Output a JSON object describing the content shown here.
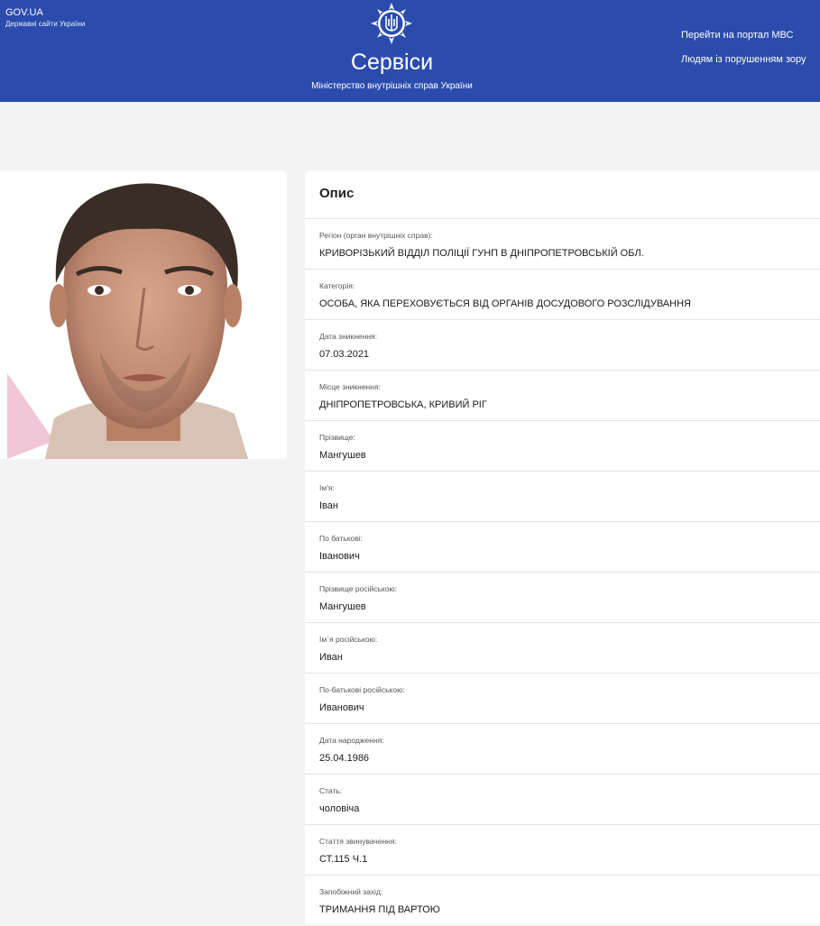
{
  "header": {
    "gov_title": "GOV.UA",
    "gov_subtitle": "Державні сайти України",
    "site_title": "Сервіси",
    "site_subtitle": "Міністерство внутрішніх справ України",
    "links": {
      "portal": "Перейти на портал МВС",
      "vision": "Людям із порушенням зору"
    },
    "colors": {
      "header_bg": "#2b4cad",
      "page_bg": "#f3f3f3"
    }
  },
  "photo": {
    "icon": "person-photo"
  },
  "description": {
    "title": "Опис",
    "fields": [
      {
        "label": "Регіон (орган внутрішніх справ):",
        "value": "КРИВОРІЗЬКИЙ ВІДДІЛ ПОЛІЦІЇ ГУНП В ДНІПРОПЕТРОВСЬКІЙ ОБЛ."
      },
      {
        "label": "Категорія:",
        "value": "ОСОБА, ЯКА ПЕРЕХОВУЄТЬСЯ ВІД ОРГАНІВ ДОСУДОВОГО РОЗСЛІДУВАННЯ"
      },
      {
        "label": "Дата зникнення:",
        "value": "07.03.2021"
      },
      {
        "label": "Місце зникнення:",
        "value": "ДНІПРОПЕТРОВСЬКА, КРИВИЙ РІГ"
      },
      {
        "label": "Прізвище:",
        "value": "Мангушев"
      },
      {
        "label": "Ім'я:",
        "value": "Іван"
      },
      {
        "label": "По батькові:",
        "value": "Іванович"
      },
      {
        "label": "Прізвище російською:",
        "value": "Мангушев"
      },
      {
        "label": "Ім`я російською:",
        "value": "Иван"
      },
      {
        "label": "По-батькові російською:",
        "value": "Иванович"
      },
      {
        "label": "Дата народження:",
        "value": "25.04.1986"
      },
      {
        "label": "Стать:",
        "value": "чоловіча"
      },
      {
        "label": "Стаття звинувачення:",
        "value": "СТ.115 Ч.1"
      },
      {
        "label": "Запобіжний захід:",
        "value": "ТРИМАННЯ ПІД ВАРТОЮ"
      }
    ]
  }
}
